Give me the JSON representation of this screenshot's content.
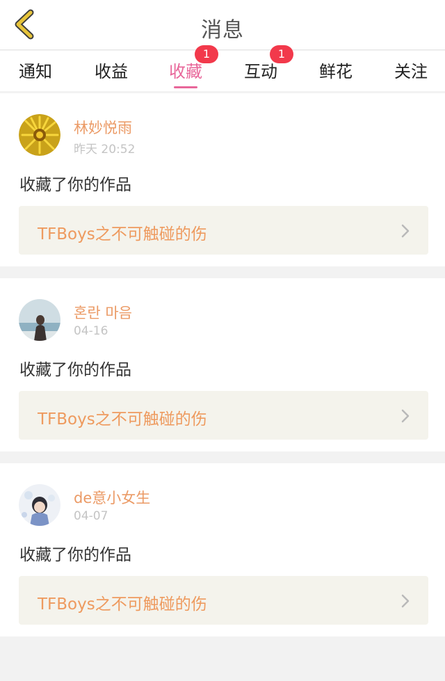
{
  "header": {
    "title": "消息",
    "back_icon": "back-chevron-icon"
  },
  "tabs": [
    {
      "label": "通知"
    },
    {
      "label": "收益"
    },
    {
      "label": "收藏",
      "active": true,
      "badge": "1"
    },
    {
      "label": "互动",
      "badge": "1"
    },
    {
      "label": "鲜花"
    },
    {
      "label": "关注"
    }
  ],
  "messages": [
    {
      "username": "林妙悦雨",
      "time": "昨天 20:52",
      "action": "收藏了你的作品",
      "work_title": "TFBoys之不可触碰的伤"
    },
    {
      "username": "혼란 마음",
      "time": "04-16",
      "action": "收藏了你的作品",
      "work_title": "TFBoys之不可触碰的伤"
    },
    {
      "username": "de意小女生",
      "time": "04-07",
      "action": "收藏了你的作品",
      "work_title": "TFBoys之不可触碰的伤"
    }
  ],
  "colors": {
    "accent_pink": "#e8679a",
    "username_orange": "#eb9a65",
    "badge_red": "#f2394b",
    "back_icon_yellow": "#e7c43a"
  }
}
